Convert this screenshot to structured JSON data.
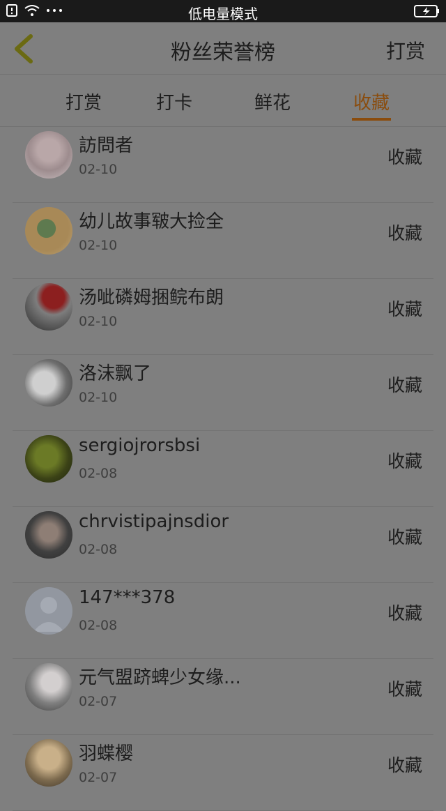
{
  "status_bar": {
    "title": "低电量模式",
    "indicators": [
      "sim-icon",
      "wifi-icon",
      "ellipsis-icon"
    ],
    "battery_icon": "battery-charging-icon"
  },
  "nav": {
    "back_icon": "chevron-left-icon",
    "title": "粉丝荣誉榜",
    "action_label": "打赏"
  },
  "tabs": [
    {
      "label": "打赏"
    },
    {
      "label": "打卡"
    },
    {
      "label": "鲜花"
    },
    {
      "label": "收藏",
      "active": true
    }
  ],
  "colors": {
    "accent": "#8a4c0d",
    "overlay_background": "#7f7f7f",
    "status_bar": "#1a1a1a"
  },
  "rows": [
    {
      "name": "訪問者",
      "date": "02-10",
      "action": "收藏"
    },
    {
      "name": "幼儿故事皲大捡全",
      "date": "02-10",
      "action": "收藏"
    },
    {
      "name": "汤呲磷姆捆鲩布朗",
      "date": "02-10",
      "action": "收藏"
    },
    {
      "name": "洛沫飘了",
      "date": "02-10",
      "action": "收藏"
    },
    {
      "name": "sergiojrorsbsi",
      "date": "02-08",
      "action": "收藏"
    },
    {
      "name": "chrvistipajnsdior",
      "date": "02-08",
      "action": "收藏"
    },
    {
      "name": "147***378",
      "date": "02-08",
      "action": "收藏"
    },
    {
      "name": "元气盟跻蜱少女缘...",
      "date": "02-07",
      "action": "收藏"
    },
    {
      "name": "羽蝶樱",
      "date": "02-07",
      "action": "收藏"
    }
  ]
}
